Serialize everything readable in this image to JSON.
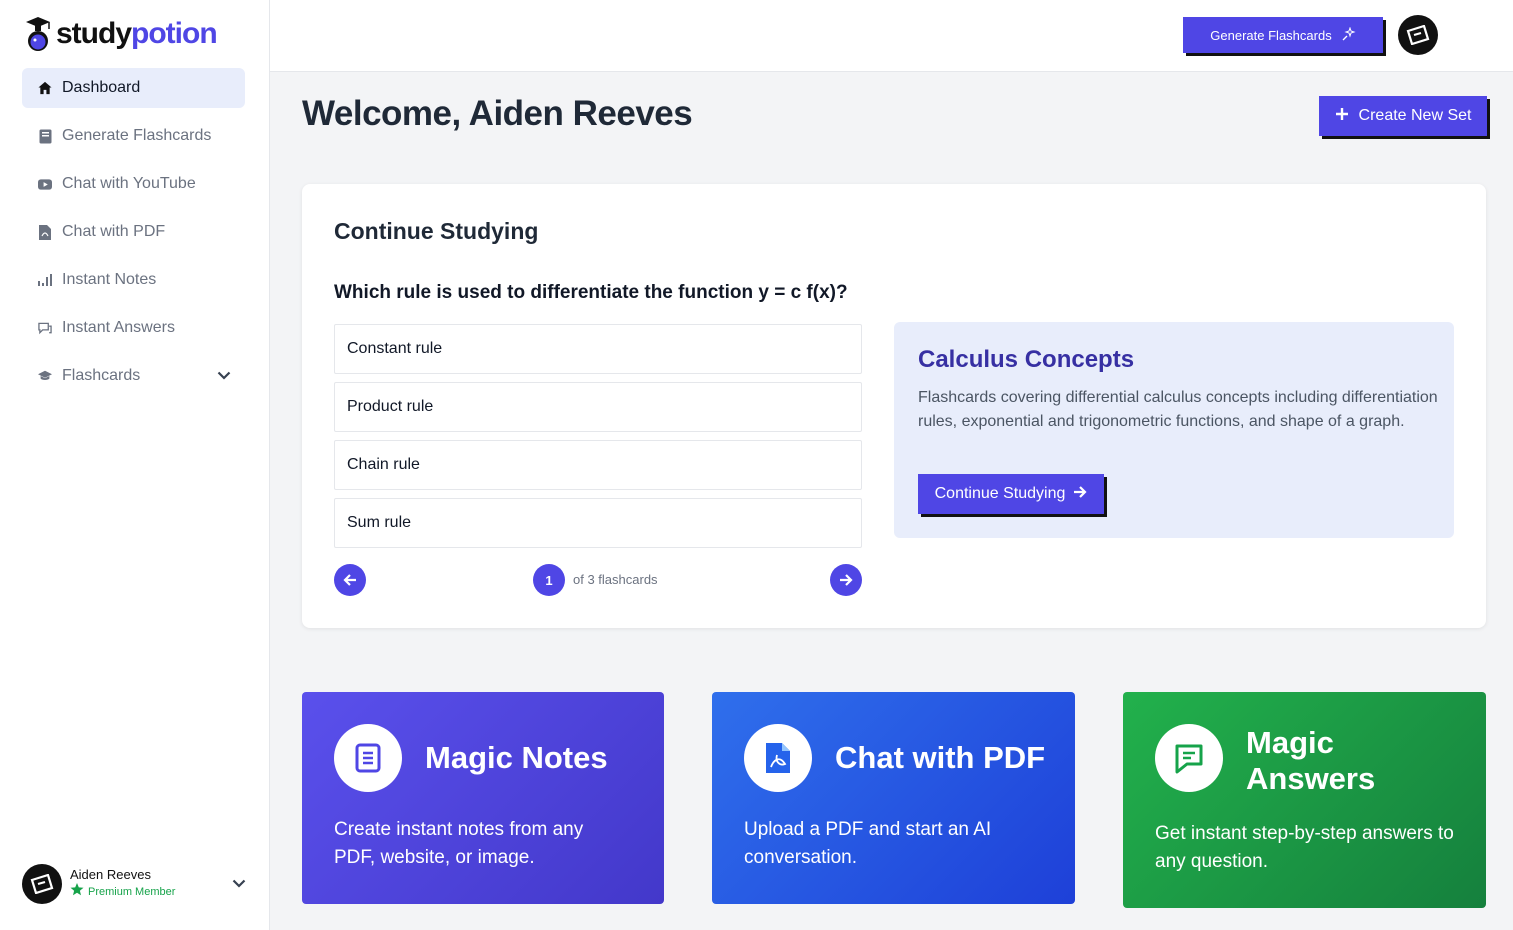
{
  "logo": {
    "part1": "study",
    "part2": "potion"
  },
  "sidebar": {
    "items": [
      {
        "label": "Dashboard",
        "icon": "home-icon"
      },
      {
        "label": "Generate Flashcards",
        "icon": "book-icon"
      },
      {
        "label": "Chat with YouTube",
        "icon": "youtube-icon"
      },
      {
        "label": "Chat with PDF",
        "icon": "pdf-icon"
      },
      {
        "label": "Instant Notes",
        "icon": "notes-icon"
      },
      {
        "label": "Instant Answers",
        "icon": "chat-icon"
      },
      {
        "label": "Flashcards",
        "icon": "graduation-cap-icon"
      }
    ]
  },
  "user": {
    "name": "Aiden Reeves",
    "role": "Premium Member"
  },
  "topbar": {
    "generate_label": "Generate Flashcards"
  },
  "main": {
    "welcome": "Welcome, Aiden Reeves",
    "create_label": "Create New Set"
  },
  "study": {
    "title": "Continue Studying",
    "question": "Which rule is used to differentiate the function y = c f(x)?",
    "options": [
      "Constant rule",
      "Product rule",
      "Chain rule",
      "Sum rule"
    ],
    "page": "1",
    "page_of": "of 3 flashcards",
    "set_title": "Calculus Concepts",
    "set_desc": "Flashcards covering differential calculus concepts including differentiation rules, exponential and trigonometric functions, and shape of a graph.",
    "continue_label": "Continue Studying"
  },
  "features": [
    {
      "title": "Magic Notes",
      "desc": "Create instant notes from any PDF, website, or image."
    },
    {
      "title": "Chat with PDF",
      "desc": "Upload a PDF and start an AI conversation."
    },
    {
      "title": "Magic Answers",
      "desc": "Get instant step-by-step answers to any question."
    }
  ],
  "colors": {
    "accent": "#4f46e5",
    "active_bg": "#e8edfb",
    "green": "#16a34a"
  }
}
